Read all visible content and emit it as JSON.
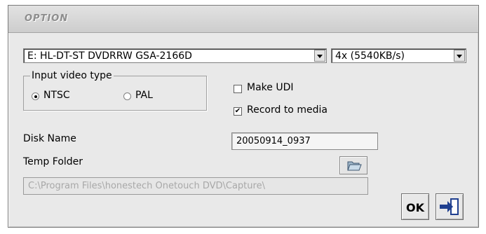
{
  "dialog": {
    "title": "OPTION"
  },
  "drive_select": {
    "value": "E: HL-DT-ST DVDRRW GSA-2166D"
  },
  "speed_select": {
    "value": "4x (5540KB/s)"
  },
  "input_video_type": {
    "legend": "Input video type",
    "options": [
      {
        "label": "NTSC",
        "selected": true
      },
      {
        "label": "PAL",
        "selected": false
      }
    ]
  },
  "make_udi": {
    "label": "Make UDI",
    "checked": false
  },
  "record_to_media": {
    "label": "Record to media",
    "checked": true,
    "check_glyph": "✔"
  },
  "disk_name": {
    "label": "Disk Name",
    "value": "20050914_0937"
  },
  "temp_folder": {
    "label": "Temp Folder",
    "path": "C:\\Program Files\\honestech Onetouch DVD\\Capture\\"
  },
  "buttons": {
    "ok_label": "OK",
    "browse_icon": "folder-open-icon",
    "exit_icon": "exit-door-icon"
  }
}
